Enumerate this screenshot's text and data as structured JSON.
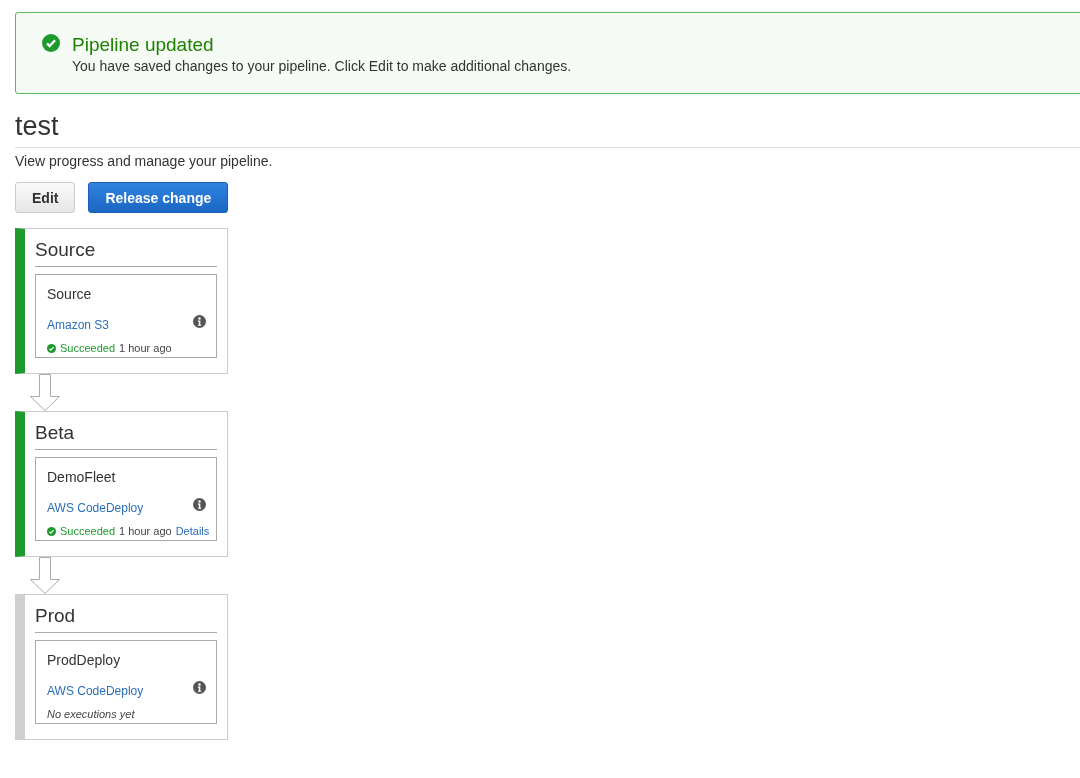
{
  "notification": {
    "kind": "success",
    "title": "Pipeline updated",
    "message": "You have saved changes to your pipeline. Click Edit to make additional changes."
  },
  "pipeline": {
    "name": "test",
    "description": "View progress and manage your pipeline."
  },
  "buttons": [
    {
      "label": "Edit",
      "kind": "secondary"
    },
    {
      "label": "Release change",
      "kind": "primary"
    }
  ],
  "stages": [
    {
      "name": "Source",
      "kind": "succeeded",
      "actions": [
        {
          "name": "Source",
          "provider": "Amazon S3",
          "result": {
            "kind": "succeeded",
            "label": "Succeeded",
            "time": "1 hour ago"
          }
        }
      ]
    },
    {
      "name": "Beta",
      "kind": "succeeded",
      "actions": [
        {
          "name": "DemoFleet",
          "provider": "AWS CodeDeploy",
          "result": {
            "kind": "succeeded",
            "label": "Succeeded",
            "time": "1 hour ago",
            "link": "Details"
          }
        }
      ]
    },
    {
      "name": "Prod",
      "kind": "idle",
      "actions": [
        {
          "name": "ProdDeploy",
          "provider": "AWS CodeDeploy",
          "result": {
            "kind": "none",
            "label": "No executions yet"
          }
        }
      ]
    }
  ]
}
